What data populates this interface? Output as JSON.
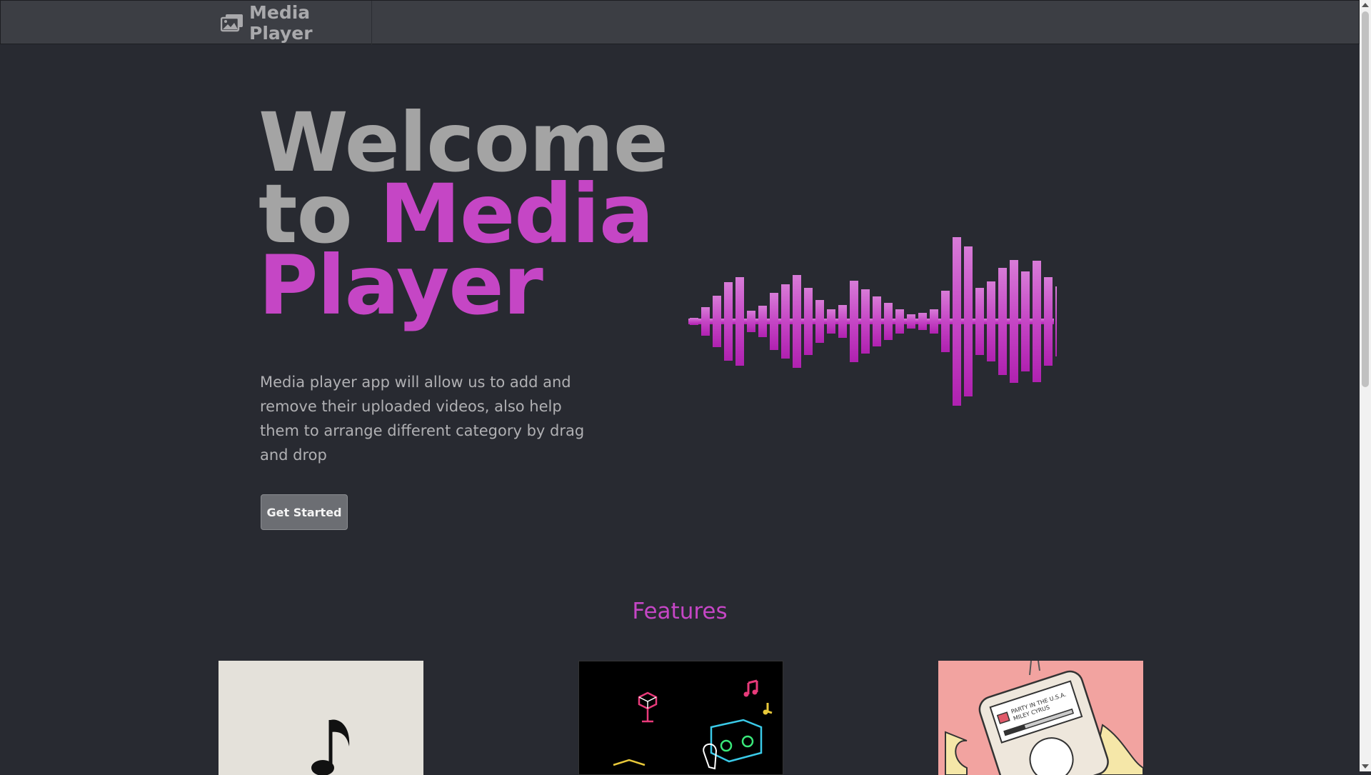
{
  "navbar": {
    "brand_text": "Media Player",
    "brand_icon": "images-icon"
  },
  "hero": {
    "title_line1": "Welcome",
    "title_to": "to ",
    "title_accent1": "Media",
    "title_accent2": "Player",
    "description": "Media player app will allow us to add and remove their uploaded videos, also help them to arrange different category by drag and drop",
    "cta_label": "Get Started"
  },
  "features": {
    "heading": "Features",
    "cards": [
      {
        "image": "music-note-illustration"
      },
      {
        "image": "neon-party-illustration"
      },
      {
        "image": "ipod-hand-illustration",
        "caption": "PARTY IN THE U.S.A. MILEY CYRUS"
      }
    ]
  },
  "colors": {
    "background": "#282a31",
    "navbar": "#3c3e44",
    "accent": "#c546c5",
    "title_gray": "#a4a4a4"
  }
}
